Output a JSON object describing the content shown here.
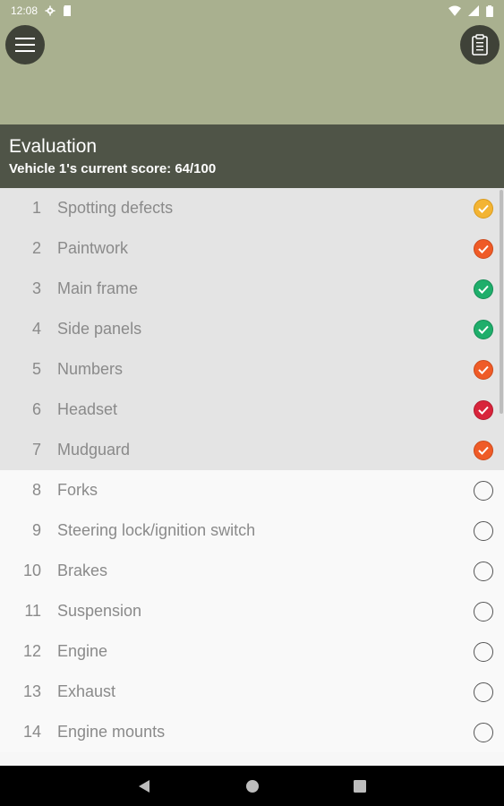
{
  "status_bar": {
    "time": "12:08",
    "icons_left": [
      "gear-icon",
      "sd-card-icon"
    ],
    "icons_right": [
      "wifi-icon",
      "signal-icon",
      "battery-icon"
    ]
  },
  "app_bar": {
    "menu_icon": "hamburger-menu-icon",
    "clipboard_icon": "clipboard-icon"
  },
  "evaluation": {
    "title": "Evaluation",
    "score_text": "Vehicle 1's current score: 64/100"
  },
  "colors": {
    "header_bg": "#a9b08f",
    "eval_bg": "#4f5447",
    "yellow": "#f3b433",
    "orange": "#ef5b27",
    "green": "#1fae6b",
    "red": "#d8243b"
  },
  "items": [
    {
      "num": "1",
      "label": "Spotting defects",
      "status": "yellow",
      "done": true
    },
    {
      "num": "2",
      "label": "Paintwork",
      "status": "orange",
      "done": true
    },
    {
      "num": "3",
      "label": "Main frame",
      "status": "green",
      "done": true
    },
    {
      "num": "4",
      "label": "Side panels",
      "status": "green",
      "done": true
    },
    {
      "num": "5",
      "label": "Numbers",
      "status": "orange",
      "done": true
    },
    {
      "num": "6",
      "label": "Headset",
      "status": "red",
      "done": true
    },
    {
      "num": "7",
      "label": "Mudguard",
      "status": "orange",
      "done": true
    },
    {
      "num": "8",
      "label": "Forks",
      "status": "empty",
      "done": false
    },
    {
      "num": "9",
      "label": "Steering lock/ignition switch",
      "status": "empty",
      "done": false
    },
    {
      "num": "10",
      "label": "Brakes",
      "status": "empty",
      "done": false
    },
    {
      "num": "11",
      "label": "Suspension",
      "status": "empty",
      "done": false
    },
    {
      "num": "12",
      "label": "Engine",
      "status": "empty",
      "done": false
    },
    {
      "num": "13",
      "label": "Exhaust",
      "status": "empty",
      "done": false
    },
    {
      "num": "14",
      "label": "Engine mounts",
      "status": "empty",
      "done": false
    }
  ],
  "nav_bar": {
    "back_icon": "back-triangle-icon",
    "home_icon": "home-circle-icon",
    "recents_icon": "recents-square-icon"
  }
}
